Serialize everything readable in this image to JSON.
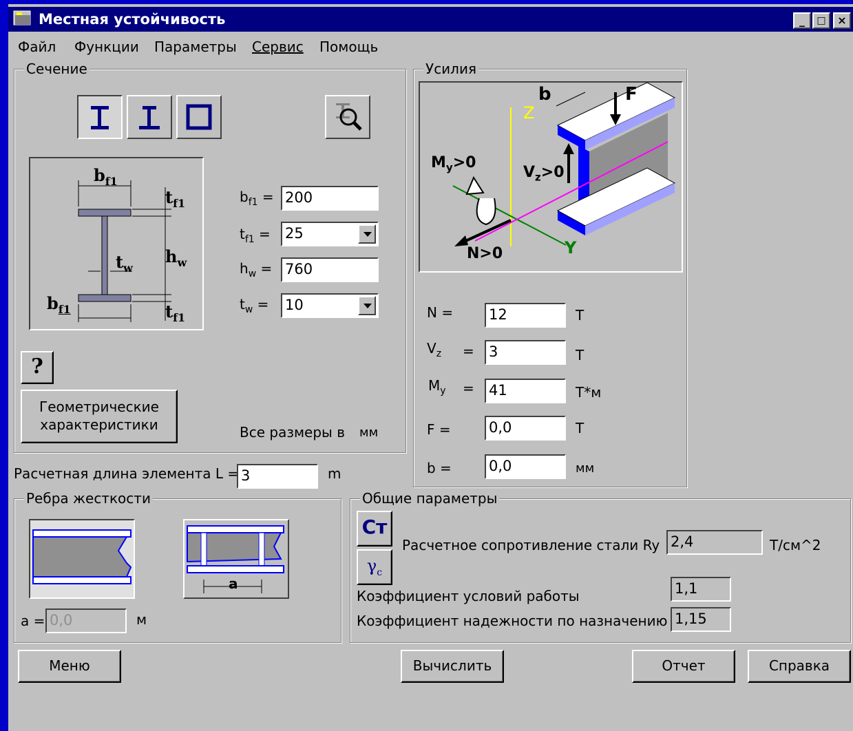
{
  "window": {
    "title": "Местная устойчивость",
    "buttons": [
      "_",
      "□",
      "×"
    ]
  },
  "menu": [
    "Файл",
    "Функции",
    "Параметры",
    "Сервис",
    "Помощь"
  ],
  "section": {
    "title": "Сечение",
    "params": [
      {
        "label": "b",
        "sub": "f1",
        "value": "200",
        "type": "text"
      },
      {
        "label": "t",
        "sub": "f1",
        "value": "25",
        "type": "dropdown"
      },
      {
        "label": "h",
        "sub": "w",
        "value": "760",
        "type": "text"
      },
      {
        "label": "t",
        "sub": "w",
        "value": "10",
        "type": "dropdown"
      }
    ],
    "equals": "=",
    "diagram_labels": {
      "bf1_top": "b",
      "bf1_bot": "b",
      "sub_f1": "f1",
      "tf1_top": "t",
      "tf1_bot": "t",
      "tw": "t",
      "sub_w": "w",
      "hw": "h"
    },
    "help_label": "?",
    "geom_button": [
      "Геометрические",
      "характеристики"
    ],
    "units_note": "Все размеры в",
    "units": "мм"
  },
  "length": {
    "label": "Расчетная длина элемента L =",
    "value": "3",
    "unit": "m"
  },
  "forces": {
    "title": "Усилия",
    "diagram_labels": {
      "z": "Z",
      "y": "Y",
      "my": "M",
      "my_sub": "y",
      "my_rest": ">0",
      "vz": "V",
      "vz_sub": "z",
      "vz_rest": ">0",
      "n": "N>0",
      "f": "F",
      "b": "b"
    },
    "rows": [
      {
        "label": "N =",
        "value": "12",
        "unit": "Т"
      },
      {
        "label": "V",
        "sub": "z",
        "eq": "=",
        "value": "3",
        "unit": "Т"
      },
      {
        "label": "M",
        "sub": "y",
        "eq": "=",
        "value": "41",
        "unit": "Т*м"
      },
      {
        "label": "F =",
        "value": "0,0",
        "unit": "Т"
      },
      {
        "label": "b =",
        "value": "0,0",
        "unit": "мм"
      }
    ]
  },
  "stiffeners": {
    "title": "Ребра жесткости",
    "a_label": "a =",
    "a_value": "0,0",
    "a_unit": "м",
    "dim_label": "a"
  },
  "general": {
    "title": "Общие параметры",
    "steel_button": "Ст",
    "gamma_button": "γ",
    "gamma_sub": "c",
    "ry_label": "Расчетное сопротивление стали Ry",
    "ry_value": "2,4",
    "ry_unit": "Т/см^2",
    "gc_label": "Коэффициент условий работы",
    "gc_value": "1,1",
    "gn_label": "Коэффициент надежности по назначению",
    "gn_value": "1,15"
  },
  "footer": {
    "menu": "Меню",
    "calc": "Вычислить",
    "report": "Отчет",
    "help": "Справка"
  },
  "colors": {
    "titlebar": "#000080",
    "window": "#c0c0c0",
    "desktop": "#0000c8",
    "beam_blue": "#0000ff",
    "axis_yellow": "#ffff00",
    "axis_green": "#008000",
    "axis_magenta": "#ff00ff"
  }
}
